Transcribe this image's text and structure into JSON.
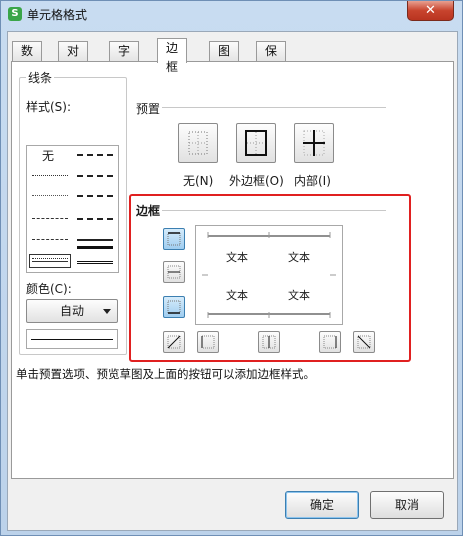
{
  "window": {
    "title": "单元格格式",
    "app_icon_letter": "S",
    "close_symbol": "✕"
  },
  "tabs": [
    {
      "label": "数字"
    },
    {
      "label": "对齐"
    },
    {
      "label": "字体"
    },
    {
      "label": "边框",
      "active": true
    },
    {
      "label": "图案"
    },
    {
      "label": "保护"
    }
  ],
  "line": {
    "group_label": "线条",
    "style_label": "样式(S):",
    "none_label": "无",
    "color_label": "颜色(C):",
    "color_value": "自动"
  },
  "preset": {
    "group_label": "预置",
    "items": [
      {
        "label": "无(N)"
      },
      {
        "label": "外边框(O)"
      },
      {
        "label": "内部(I)"
      }
    ]
  },
  "border": {
    "group_label": "边框",
    "preview_text": [
      "文本",
      "文本",
      "文本",
      "文本"
    ]
  },
  "hint": "单击预置选项、预览草图及上面的按钮可以添加边框样式。",
  "footer": {
    "ok_label": "确定",
    "cancel_label": "取消"
  },
  "colors": {
    "highlight": "#e02020",
    "accent": "#3c7fb1"
  }
}
